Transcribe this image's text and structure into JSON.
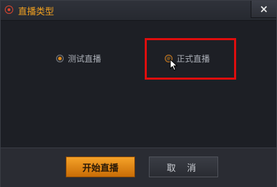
{
  "window": {
    "title": "直播类型",
    "close_label": "×"
  },
  "options": [
    {
      "label": "测试直播",
      "checked": true
    },
    {
      "label": "正式直播",
      "checked": false
    }
  ],
  "buttons": {
    "start_label": "开始直播",
    "cancel_label": "取 消"
  },
  "colors": {
    "accent": "#f0a020",
    "highlight_border": "#e00d0d",
    "background": "#1d1f25"
  },
  "icons": {
    "app": "record-icon",
    "close": "close-icon",
    "cursor": "mouse-pointer-icon"
  }
}
